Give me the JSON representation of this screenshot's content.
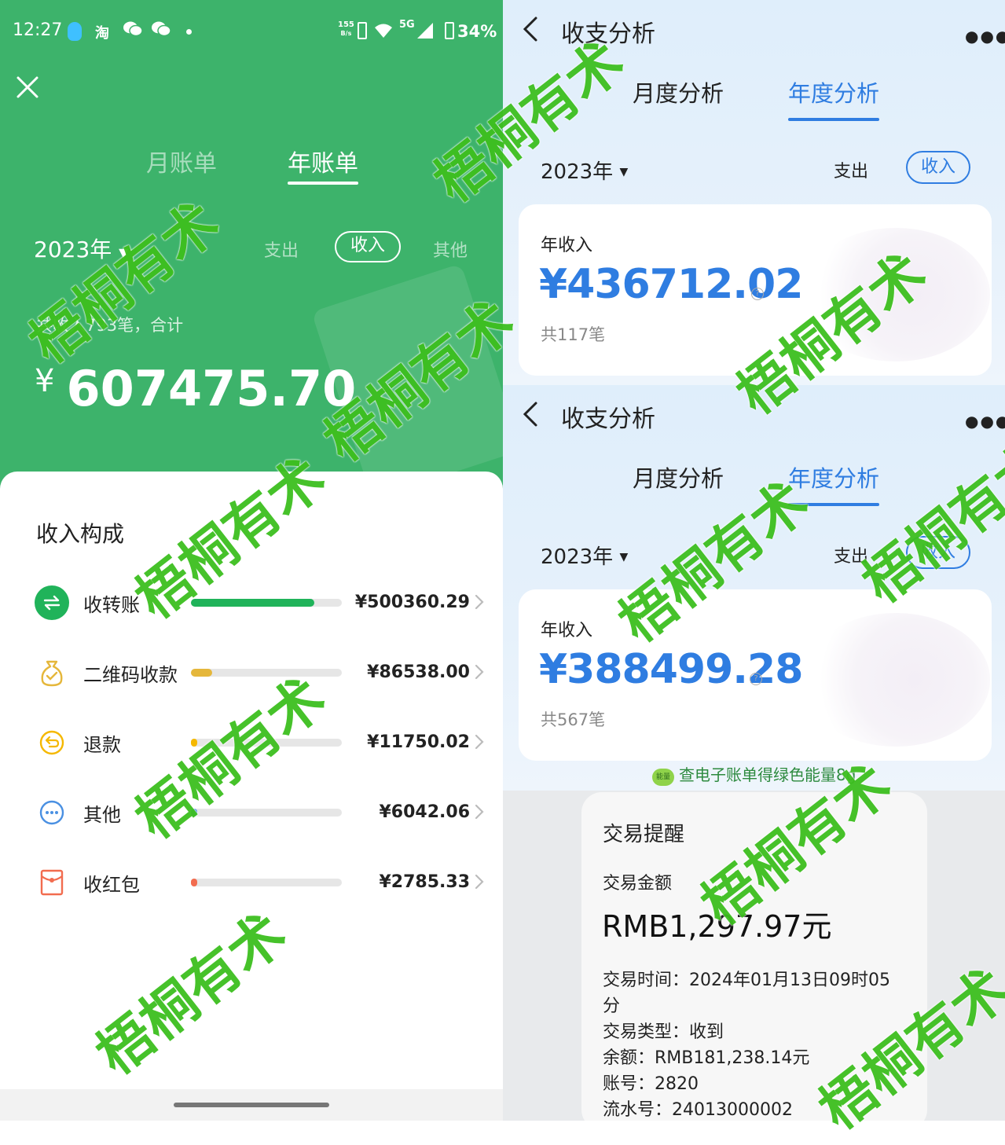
{
  "left": {
    "status": {
      "time": "12:27",
      "network_speed": "155",
      "network_unit": "B/s",
      "net_type": "5G",
      "battery": "34%"
    },
    "tabs": [
      "月账单",
      "年账单"
    ],
    "year": "2023年",
    "filters": {
      "expense": "支出",
      "income": "收入",
      "other": "其他"
    },
    "summary_text": "共收入793笔，合计",
    "total_symbol": "¥",
    "total": "607475.70",
    "section_title": "收入构成",
    "rows": [
      {
        "label": "收转账",
        "amount": "¥500360.29",
        "fraction": 0.82,
        "color": "#20b35a",
        "icon": "transfer-icon"
      },
      {
        "label": "二维码收款",
        "amount": "¥86538.00",
        "fraction": 0.14,
        "color": "#e5b73b",
        "icon": "money-bag-icon"
      },
      {
        "label": "退款",
        "amount": "¥11750.02",
        "fraction": 0.04,
        "color": "#f5b800",
        "icon": "refund-icon"
      },
      {
        "label": "其他",
        "amount": "¥6042.06",
        "fraction": 0.03,
        "color": "#4a90e2",
        "icon": "more-icon"
      },
      {
        "label": "收红包",
        "amount": "¥2785.33",
        "fraction": 0.02,
        "color": "#f26c4f",
        "icon": "red-packet-icon"
      }
    ]
  },
  "right": {
    "screens": [
      {
        "title": "收支分析",
        "tabs": [
          "月度分析",
          "年度分析"
        ],
        "year": "2023年",
        "expense": "支出",
        "income": "收入",
        "card_label": "年收入",
        "amount": "¥436712.02",
        "count": "共117笔"
      },
      {
        "title": "收支分析",
        "tabs": [
          "月度分析",
          "年度分析"
        ],
        "year": "2023年",
        "expense": "支出",
        "income": "收入",
        "card_label": "年收入",
        "amount": "¥388499.28",
        "count": "共567笔",
        "promo_badge": "能量",
        "promo": "查电子账单得绿色能量8g"
      }
    ],
    "sms": {
      "title": "交易提醒",
      "amount_label": "交易金额",
      "amount": "RMB1,297.97元",
      "lines": [
        "交易时间：2024年01月13日09时05",
        "分",
        "交易类型：收到",
        "余额：RMB181,238.14元",
        "账号：2820",
        "流水号：24013000002"
      ]
    }
  },
  "watermark": "梧桐有术"
}
